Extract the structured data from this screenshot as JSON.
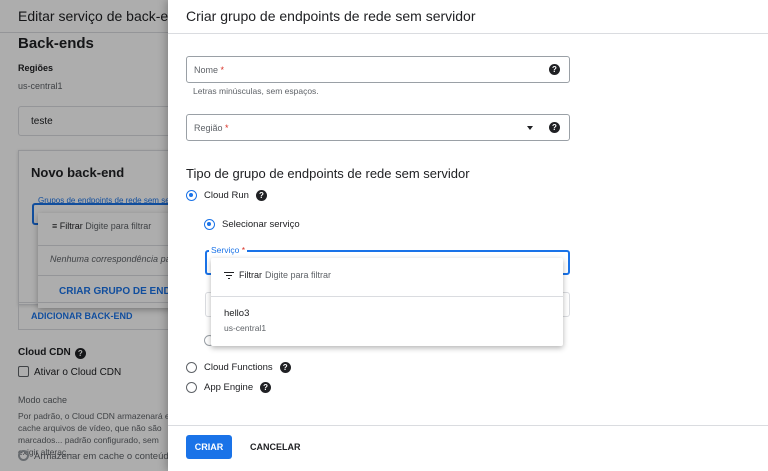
{
  "background": {
    "title": "Editar serviço de back-end",
    "section_title": "Back-ends",
    "regions_label": "Regiões",
    "regions_value": "us-central1",
    "name_value": "teste",
    "new_backend_title": "Novo back-end",
    "neg_field_label": "Grupos de endpoints de rede sem servidor",
    "dropdown": {
      "filter_label": "Filtrar",
      "filter_placeholder": "Digite para filtrar",
      "no_match": "Nenhuma correspondência para",
      "create_link": "CRIAR GRUPO DE ENDPOINTS"
    },
    "add_backend": "ADICIONAR BACK-END",
    "cdn_label": "Cloud CDN",
    "cdn_checkbox": "Ativar o Cloud CDN",
    "cache_mode_label": "Modo cache",
    "cache_mode_desc": "Por padrão, o Cloud CDN armazenará em cache arquivos de vídeo, que não são marcados... padrão configurado, sem exigir alteraç...",
    "cache_option": "Armazenar em cache o conteúdo"
  },
  "panel": {
    "title": "Criar grupo de endpoints de rede sem servidor",
    "name_field": {
      "label": "Nome",
      "required": "*",
      "hint": "Letras minúsculas, sem espaços."
    },
    "region_field": {
      "label": "Região",
      "required": "*"
    },
    "type_title": "Tipo de grupo de endpoints de rede sem servidor",
    "types": [
      {
        "label": "Cloud Run",
        "selected": true
      },
      {
        "label": "Cloud Functions",
        "selected": false
      },
      {
        "label": "App Engine",
        "selected": false
      }
    ],
    "select_service": "Selecionar serviço",
    "service_field": {
      "label": "Serviço",
      "required": "*"
    },
    "service_dropdown": {
      "filter_label": "Filtrar",
      "filter_placeholder": "Digite para filtrar",
      "items": [
        {
          "name": "hello3",
          "region": "us-central1"
        }
      ]
    },
    "create_button": "CRIAR",
    "cancel_button": "CANCELAR",
    "help_glyph": "?"
  },
  "colors": {
    "accent": "#1a73e8",
    "required": "#d93025",
    "text": "#202124",
    "muted": "#5f6368"
  },
  "icons": [
    "help-icon",
    "dropdown-arrow-icon",
    "filter-icon",
    "radio-icon",
    "checkbox-icon"
  ]
}
